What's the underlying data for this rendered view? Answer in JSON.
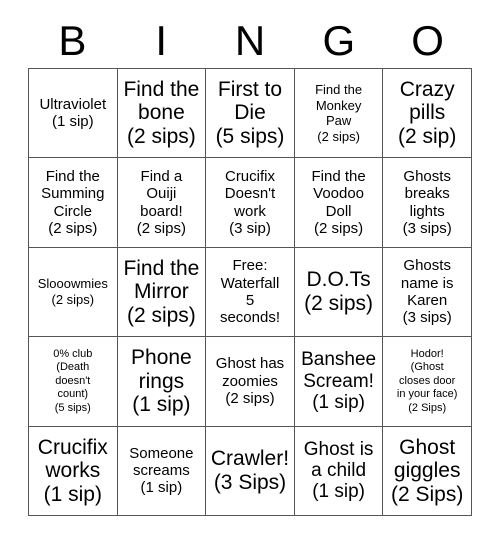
{
  "header": {
    "letters": [
      "B",
      "I",
      "N",
      "G",
      "O"
    ]
  },
  "grid": {
    "rows": 5,
    "columns": 5,
    "cells": [
      {
        "id": "b1",
        "lines": [
          "Ultraviolet",
          "(1 sip)"
        ],
        "size": "fs-md"
      },
      {
        "id": "i1",
        "lines": [
          "Find the",
          "bone",
          "(2 sips)"
        ],
        "size": "fs-xl"
      },
      {
        "id": "n1",
        "lines": [
          "First to",
          "Die",
          "(5 sips)"
        ],
        "size": "fs-xl"
      },
      {
        "id": "g1",
        "lines": [
          "Find the",
          "Monkey",
          "Paw",
          "(2 sips)"
        ],
        "size": "fs-sm"
      },
      {
        "id": "o1",
        "lines": [
          "Crazy",
          "pills",
          "(2 sip)"
        ],
        "size": "fs-xl"
      },
      {
        "id": "b2",
        "lines": [
          "Find the",
          "Summing",
          "Circle",
          "(2 sips)"
        ],
        "size": "fs-md"
      },
      {
        "id": "i2",
        "lines": [
          "Find a",
          "Ouiji",
          "board!",
          "(2 sips)"
        ],
        "size": "fs-md"
      },
      {
        "id": "n2",
        "lines": [
          "Crucifix",
          "Doesn't",
          "work",
          "(3 sip)"
        ],
        "size": "fs-md"
      },
      {
        "id": "g2",
        "lines": [
          "Find the",
          "Voodoo",
          "Doll",
          "(2 sips)"
        ],
        "size": "fs-md"
      },
      {
        "id": "o2",
        "lines": [
          "Ghosts",
          "breaks",
          "lights",
          "(3 sips)"
        ],
        "size": "fs-md"
      },
      {
        "id": "b3",
        "lines": [
          "Slooowmies",
          "(2 sips)"
        ],
        "size": "fs-sm"
      },
      {
        "id": "i3",
        "lines": [
          "Find the",
          "Mirror",
          "(2 sips)"
        ],
        "size": "fs-xl"
      },
      {
        "id": "n3",
        "lines": [
          "Free:",
          "Waterfall",
          "5",
          "seconds!"
        ],
        "size": "fs-md"
      },
      {
        "id": "g3",
        "lines": [
          "D.O.Ts",
          "(2 sips)"
        ],
        "size": "fs-xl"
      },
      {
        "id": "o3",
        "lines": [
          "Ghosts",
          "name is",
          "Karen",
          "(3 sips)"
        ],
        "size": "fs-md"
      },
      {
        "id": "b4",
        "lines": [
          "0% club",
          "(Death",
          "doesn't",
          "count)",
          "(5 sips)"
        ],
        "size": "fs-xs"
      },
      {
        "id": "i4",
        "lines": [
          "Phone",
          "rings",
          "(1 sip)"
        ],
        "size": "fs-xl"
      },
      {
        "id": "n4",
        "lines": [
          "Ghost has",
          "zoomies",
          "(2 sips)"
        ],
        "size": "fs-md"
      },
      {
        "id": "g4",
        "lines": [
          "Banshee",
          "Scream!",
          "(1 sip)"
        ],
        "size": "fs-lg"
      },
      {
        "id": "o4",
        "lines": [
          "Hodor!",
          "(Ghost",
          "closes door",
          "in your face)",
          "(2 Sips)"
        ],
        "size": "fs-xs"
      },
      {
        "id": "b5",
        "lines": [
          "Crucifix",
          "works",
          "(1 sip)"
        ],
        "size": "fs-xl"
      },
      {
        "id": "i5",
        "lines": [
          "Someone",
          "screams",
          "(1 sip)"
        ],
        "size": "fs-md"
      },
      {
        "id": "n5",
        "lines": [
          "Crawler!",
          "(3 Sips)"
        ],
        "size": "fs-xl"
      },
      {
        "id": "g5",
        "lines": [
          "Ghost is",
          "a child",
          "(1 sip)"
        ],
        "size": "fs-lg"
      },
      {
        "id": "o5",
        "lines": [
          "Ghost",
          "giggles",
          "(2 Sips)"
        ],
        "size": "fs-xl"
      }
    ]
  },
  "colors": {
    "background": "#ffffff",
    "text": "#000000",
    "grid_line": "#555555"
  }
}
